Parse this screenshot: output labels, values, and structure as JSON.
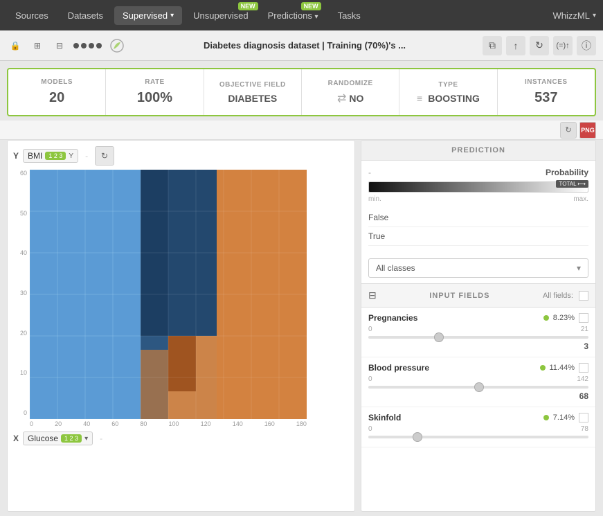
{
  "nav": {
    "sources": "Sources",
    "datasets": "Datasets",
    "supervised": "Supervised",
    "supervised_arrow": "▾",
    "unsupervised": "Unsupervised",
    "unsupervised_badge": "NEW",
    "predictions": "Predictions",
    "predictions_badge": "NEW",
    "predictions_arrow": "▾",
    "tasks": "Tasks",
    "whizzml": "WhizzML",
    "whizzml_arrow": "▾"
  },
  "toolbar": {
    "lock_icon": "🔒",
    "title": "Diabetes diagnosis dataset | Training (70%)'s ...",
    "copy_icon": "⧉",
    "upload_icon": "↑",
    "refresh_icon": "↻",
    "formula_icon": "(=)↑",
    "info_icon": "ⓘ"
  },
  "stats": {
    "models_label": "MODELS",
    "models_value": "20",
    "rate_label": "RATE",
    "rate_value": "100%",
    "objective_label": "OBJECTIVE FIELD",
    "objective_value": "DIABETES",
    "randomize_label": "RANDOMIZE",
    "randomize_value": "NO",
    "type_label": "TYPE",
    "type_value": "BOOSTING",
    "instances_label": "INSTANCES",
    "instances_value": "537"
  },
  "subtoolbar": {
    "refresh": "↻",
    "png": "PNG"
  },
  "chart": {
    "y_axis_label": "Y",
    "y_field": "BMI",
    "y_field_badge": "1 2 3",
    "y_separator": "-",
    "x_axis_label": "X",
    "x_field": "Glucose",
    "x_field_badge": "1 2 3",
    "x_separator": "-",
    "y_ticks": [
      "0",
      "10",
      "20",
      "30",
      "40",
      "50",
      "60"
    ],
    "x_ticks": [
      "0",
      "20",
      "40",
      "60",
      "80",
      "100",
      "120",
      "140",
      "160",
      "180"
    ]
  },
  "prediction": {
    "header": "PREDICTION",
    "dash": "-",
    "probability_label": "Probability",
    "min_label": "min.",
    "max_label": "max.",
    "total_label": "TOTAL",
    "false_label": "False",
    "true_label": "True",
    "all_classes": "All classes"
  },
  "input_fields": {
    "header": "INPUT FIELDS",
    "all_fields": "All fields:",
    "pregnancies": {
      "name": "Pregnancies",
      "pct": "8.23%",
      "min": "0",
      "max": "21",
      "thumb_pos": "75",
      "value": "3"
    },
    "blood_pressure": {
      "name": "Blood pressure",
      "pct": "11.44%",
      "min": "0",
      "max": "142",
      "thumb_pos": "60",
      "value": "68"
    },
    "skinfold": {
      "name": "Skinfold",
      "pct": "7.14%",
      "min": "0",
      "max": "78"
    }
  }
}
